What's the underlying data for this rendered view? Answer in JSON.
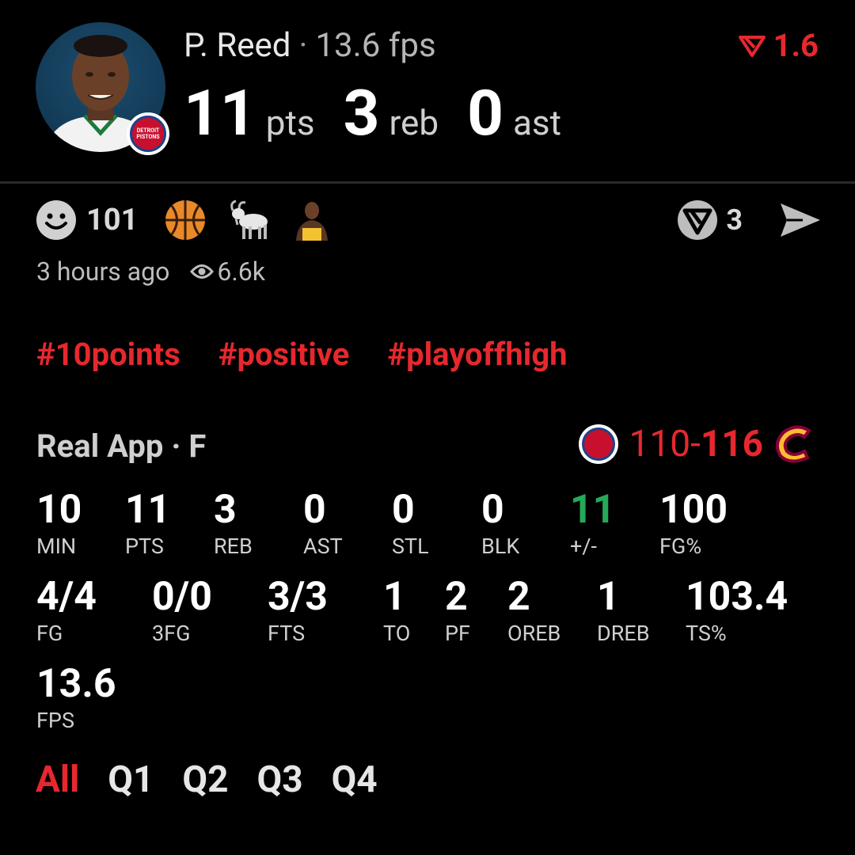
{
  "player": {
    "name": "P. Reed",
    "separator": "·",
    "fps_label": "13.6 fps",
    "delta": "1.6",
    "team_badge": [
      "DETROIT",
      "PISTONS"
    ]
  },
  "statline": [
    {
      "value": "11",
      "unit": "pts"
    },
    {
      "value": "3",
      "unit": "reb"
    },
    {
      "value": "0",
      "unit": "ast"
    }
  ],
  "reactions": {
    "smiley_count": "101",
    "icons": [
      "smiley-icon",
      "basketball-icon",
      "goat-icon",
      "player-sticker-icon"
    ],
    "reshare_count": "3"
  },
  "meta": {
    "time_ago": "3 hours ago",
    "views": "6.6k"
  },
  "tags": [
    "#10points",
    "#positive",
    "#playoffhigh"
  ],
  "game": {
    "source": "Real App · F",
    "home_score": "110-",
    "away_score": "116"
  },
  "stats_row1": [
    {
      "value": "10",
      "label": "MIN"
    },
    {
      "value": "11",
      "label": "PTS"
    },
    {
      "value": "3",
      "label": "REB"
    },
    {
      "value": "0",
      "label": "AST"
    },
    {
      "value": "0",
      "label": "STL"
    },
    {
      "value": "0",
      "label": "BLK"
    },
    {
      "value": "11",
      "label": "+/-"
    },
    {
      "value": "100",
      "label": "FG%"
    }
  ],
  "stats_row2": [
    {
      "value": "4/4",
      "label": "FG"
    },
    {
      "value": "0/0",
      "label": "3FG"
    },
    {
      "value": "3/3",
      "label": "FTS"
    },
    {
      "value": "1",
      "label": "TO"
    },
    {
      "value": "2",
      "label": "PF"
    },
    {
      "value": "2",
      "label": "OREB"
    },
    {
      "value": "1",
      "label": "DREB"
    },
    {
      "value": "103.4",
      "label": "TS%"
    }
  ],
  "stats_row3": [
    {
      "value": "13.6",
      "label": "FPS"
    }
  ],
  "quarters": [
    "All",
    "Q1",
    "Q2",
    "Q3",
    "Q4"
  ],
  "colors": {
    "accent_red": "#e6282e",
    "positive_green": "#25a95a",
    "background": "#000000"
  }
}
